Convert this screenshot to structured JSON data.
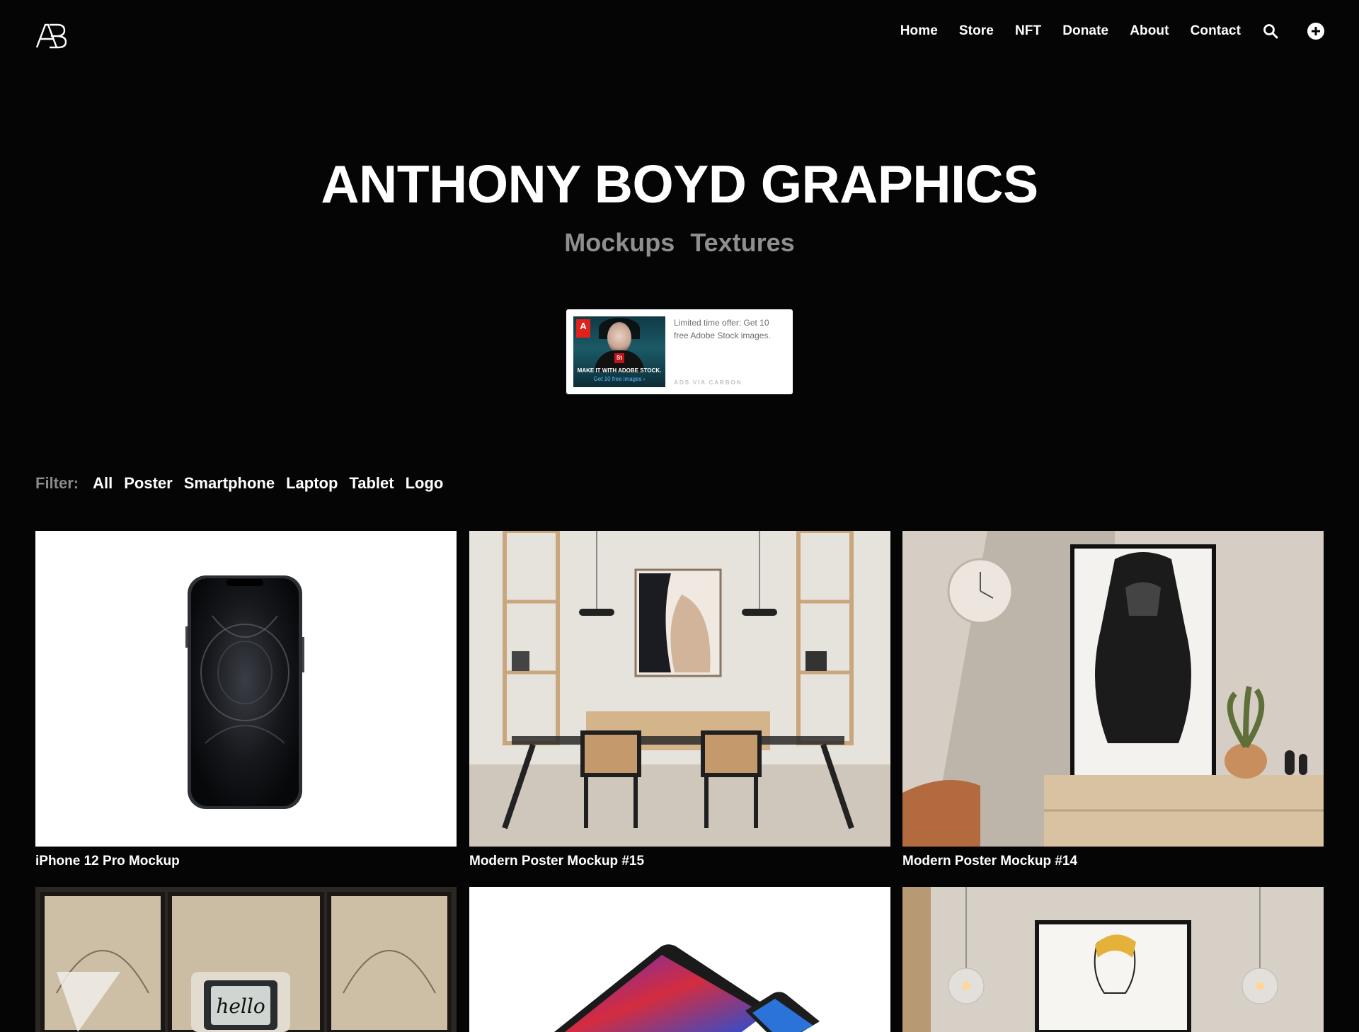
{
  "header": {
    "logo_text": "AB",
    "nav": [
      "Home",
      "Store",
      "NFT",
      "Donate",
      "About",
      "Contact"
    ],
    "icons": [
      "search-icon",
      "plus-circle-icon"
    ]
  },
  "hero": {
    "title": "ANTHONY BOYD GRAPHICS",
    "links": [
      "Mockups",
      "Textures"
    ]
  },
  "ad": {
    "image_caption_1": "MAKE IT WITH ADOBE STOCK.",
    "image_caption_2": "Get 10 free images ›",
    "brand_mark": "Adobe",
    "text": "Limited time offer: Get 10 free Adobe Stock images.",
    "via": "ADS VIA CARBON"
  },
  "filter": {
    "label": "Filter:",
    "options": [
      "All",
      "Poster",
      "Smartphone",
      "Laptop",
      "Tablet",
      "Logo"
    ]
  },
  "items": [
    {
      "title": "iPhone 12 Pro Mockup"
    },
    {
      "title": "Modern Poster Mockup #15"
    },
    {
      "title": "Modern Poster Mockup #14"
    },
    {
      "title": ""
    },
    {
      "title": ""
    },
    {
      "title": ""
    }
  ],
  "thumb_texts": {
    "hello": "hello"
  },
  "colors": {
    "background": "#050505",
    "text": "#ffffff",
    "muted": "#8f8f8f"
  }
}
